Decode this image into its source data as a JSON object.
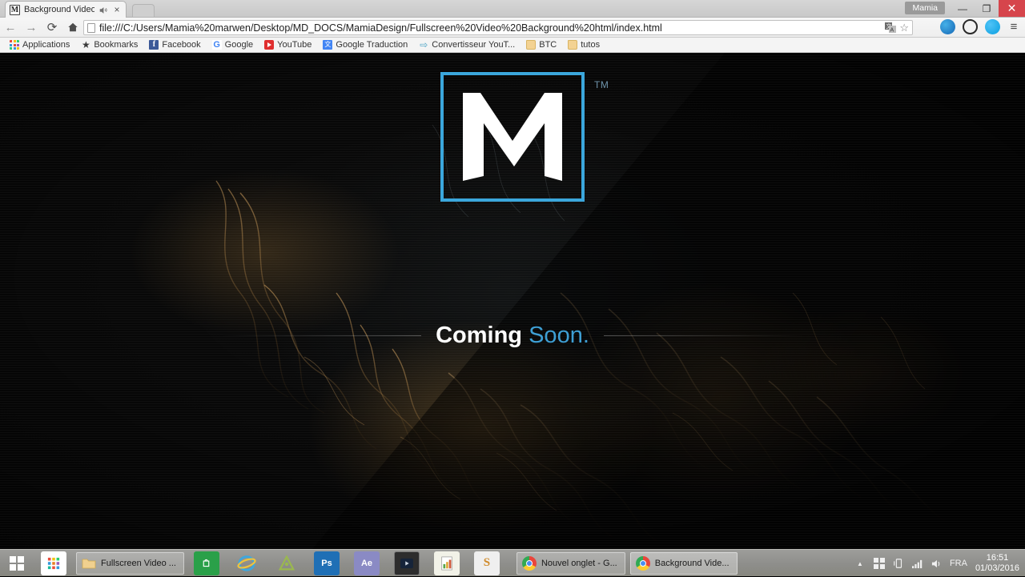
{
  "browser": {
    "tab": {
      "favicon_letter": "M",
      "title": "Background Video",
      "audio_icon": "speaker-icon",
      "close_icon": "×"
    },
    "window": {
      "profile_name": "Mamia",
      "minimize": "—",
      "maximize": "❐",
      "close": "✕"
    },
    "nav": {
      "back_icon": "←",
      "forward_icon": "→",
      "reload_icon": "⟳",
      "home_icon": "⌂"
    },
    "omnibox": {
      "url": "file:///C:/Users/Mamia%20marwen/Desktop/MD_DOCS/MamiaDesign/Fullscreen%20Video%20Background%20html/index.html",
      "translate_icon": "translate-icon",
      "star_icon": "☆"
    },
    "extensions": [
      {
        "name": "flow-extension-icon"
      },
      {
        "name": "opera-extension-icon"
      },
      {
        "name": "skype-extension-icon"
      }
    ],
    "menu_icon": "≡",
    "bookmarks": [
      {
        "label": "Applications",
        "icon": "apps-grid-icon",
        "type": "apps"
      },
      {
        "label": "Bookmarks",
        "icon": "star-icon",
        "type": "star"
      },
      {
        "label": "Facebook",
        "icon": "facebook-icon",
        "type": "fb",
        "glyph": "f"
      },
      {
        "label": "Google",
        "icon": "google-icon",
        "type": "g",
        "glyph": "G"
      },
      {
        "label": "YouTube",
        "icon": "youtube-icon",
        "type": "yt"
      },
      {
        "label": "Google Traduction",
        "icon": "google-translate-icon",
        "type": "gt",
        "glyph": "文"
      },
      {
        "label": "Convertisseur YouT...",
        "icon": "converter-icon",
        "type": "conv",
        "glyph": "⇨"
      },
      {
        "label": "BTC",
        "icon": "folder-icon",
        "type": "folder"
      },
      {
        "label": "tutos",
        "icon": "folder-icon",
        "type": "folder"
      }
    ]
  },
  "page": {
    "logo": {
      "letter": "M",
      "trademark": "TM",
      "border_color": "#3ba7dc"
    },
    "tagline": {
      "word1": "Coming",
      "word2": "Soon.",
      "word1_color": "#ffffff",
      "word2_color": "#3e9fd4"
    },
    "background_color": "#090909"
  },
  "taskbar": {
    "start_icon": "windows-logo-icon",
    "pinned": [
      {
        "name": "apps-tile-icon",
        "label": ""
      },
      {
        "name": "folder-explorer-icon",
        "label": ""
      },
      {
        "name": "windows-store-icon",
        "label": ""
      },
      {
        "name": "internet-explorer-icon",
        "label": ""
      },
      {
        "name": "android-studio-icon",
        "label": ""
      },
      {
        "name": "photoshop-icon",
        "label": "Ps"
      },
      {
        "name": "after-effects-icon",
        "label": "Ae"
      },
      {
        "name": "media-player-icon",
        "label": ""
      },
      {
        "name": "notepad-editor-icon",
        "label": ""
      },
      {
        "name": "sublime-text-icon",
        "label": "S"
      }
    ],
    "tasks": [
      {
        "label": "Fullscreen Video ...",
        "icon": "folder-icon",
        "active": false
      },
      {
        "label": "Nouvel onglet - G...",
        "icon": "chrome-icon",
        "active": false
      },
      {
        "label": "Background Vide...",
        "icon": "chrome-icon",
        "active": true
      }
    ],
    "tray": {
      "show_hidden_icon": "▲",
      "action_center_icon": "windows-flag-icon",
      "device_icon": "device-icon",
      "network_icon": "signal-bars-icon",
      "volume_icon": "🔊",
      "language": "FRA",
      "time": "16:51",
      "date": "01/03/2016"
    }
  }
}
